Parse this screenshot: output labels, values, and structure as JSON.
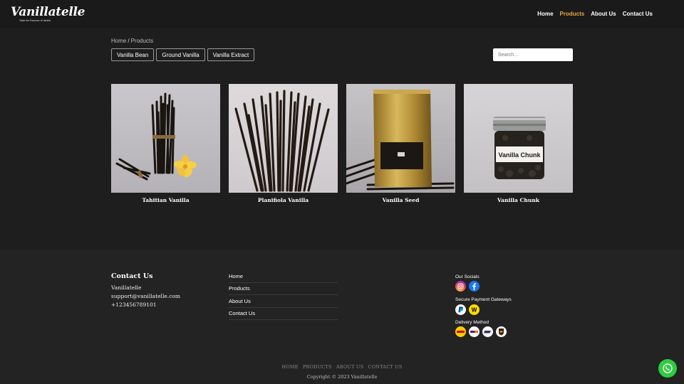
{
  "brand": {
    "name": "Vanillatelle",
    "tagline": "Taste the Essence of Vanilla"
  },
  "nav": {
    "home": "Home",
    "products": "Products",
    "about": "About Us",
    "contact": "Contact Us"
  },
  "breadcrumb": {
    "home": "Home",
    "separator": "/",
    "current": "Products"
  },
  "filters": [
    "Vanilla Bean",
    "Ground Vanilla",
    "Vanilla Extract"
  ],
  "search": {
    "placeholder": "Search..."
  },
  "products": [
    {
      "name": "Tahitian Vanilla"
    },
    {
      "name": "Planifiola Vanilla"
    },
    {
      "name": "Vanilla Seed"
    },
    {
      "name": "Vanilla Chunk",
      "jar_label": "Vanilla Chunk"
    }
  ],
  "footer": {
    "contact": {
      "title": "Contact Us",
      "company": "Vanillatelle",
      "email": "support@vanillatelle.com",
      "phone": "+123456789101"
    },
    "links": [
      "Home",
      "Products",
      "About Us",
      "Contact Us"
    ],
    "socials_label": "Our Socials",
    "payments_label": "Secure Payment Gateways",
    "delivery_label": "Delivery Method",
    "bottom_links": [
      "HOME",
      "PRODUCTS",
      "ABOUT US",
      "CONTACT US"
    ],
    "copyright": "Copyright © 2023 Vanillatelle"
  },
  "icons": {
    "social": [
      "instagram-icon",
      "facebook-icon"
    ],
    "payment": [
      "paypal-icon",
      "western-union-icon"
    ],
    "delivery": [
      "dhl-icon",
      "fedex-icon",
      "usps-icon",
      "ups-icon"
    ],
    "chat": "whatsapp-icon"
  },
  "colors": {
    "accent": "#e8a64a",
    "background": "#1e1e1e",
    "footer": "#232323",
    "whatsapp": "#2ecc40"
  }
}
